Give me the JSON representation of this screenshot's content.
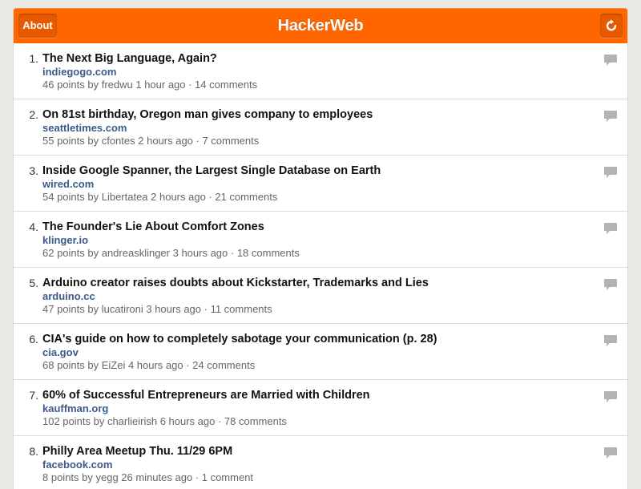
{
  "header": {
    "title": "HackerWeb",
    "about_label": "About",
    "refresh_icon": "refresh-icon",
    "color": "#ff6600"
  },
  "stories": [
    {
      "rank": "1.",
      "title": "The Next Big Language, Again?",
      "domain": "indiegogo.com",
      "meta": "46 points by fredwu 1 hour ago · 14 comments"
    },
    {
      "rank": "2.",
      "title": "On 81st birthday, Oregon man gives company to employees",
      "domain": "seattletimes.com",
      "meta": "55 points by cfontes 2 hours ago · 7 comments"
    },
    {
      "rank": "3.",
      "title": "Inside Google Spanner, the Largest Single Database on Earth",
      "domain": "wired.com",
      "meta": "54 points by Libertatea 2 hours ago · 21 comments"
    },
    {
      "rank": "4.",
      "title": "The Founder's Lie About Comfort Zones",
      "domain": "klinger.io",
      "meta": "62 points by andreasklinger 3 hours ago · 18 comments"
    },
    {
      "rank": "5.",
      "title": "Arduino creator raises doubts about Kickstarter, Trademarks and Lies",
      "domain": "arduino.cc",
      "meta": "47 points by lucatironi 3 hours ago · 11 comments"
    },
    {
      "rank": "6.",
      "title": "CIA's guide on how to completely sabotage your communication (p. 28)",
      "domain": "cia.gov",
      "meta": "68 points by EiZei 4 hours ago · 24 comments"
    },
    {
      "rank": "7.",
      "title": "60% of Successful Entrepreneurs are Married with Children",
      "domain": "kauffman.org",
      "meta": "102 points by charlieirish 6 hours ago · 78 comments"
    },
    {
      "rank": "8.",
      "title": "Philly Area Meetup Thu. 11/29 6PM",
      "domain": "facebook.com",
      "meta": "8 points by yegg 26 minutes ago · 1 comment"
    }
  ],
  "icons": {
    "comments": "speech-bubble-icon"
  }
}
